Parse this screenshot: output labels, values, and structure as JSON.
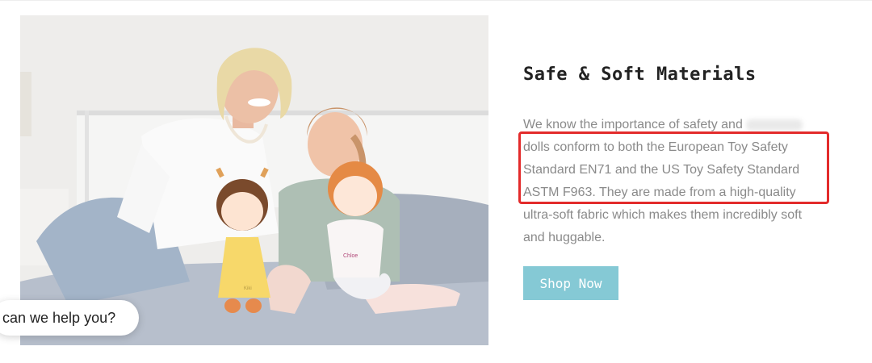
{
  "feature": {
    "heading": "Safe & Soft Materials",
    "paragraph_lines": [
      "We know the importance of safety and",
      "dolls conform to both the European Toy Safety",
      "Standard EN71 and the US Toy Safety Standard",
      "ASTM F963. They are made from a high-quality",
      "ultra-soft fabric which makes them incredibly soft",
      "and huggable."
    ],
    "cta_label": "Shop Now"
  },
  "photo": {
    "doll_name": "Chloe",
    "doll_tag": "Kiki"
  },
  "chat": {
    "label": "can we help you?"
  },
  "colors": {
    "button_bg": "#85c9d5",
    "highlight_border": "#e32b2b",
    "body_text": "#8a8a8a"
  }
}
